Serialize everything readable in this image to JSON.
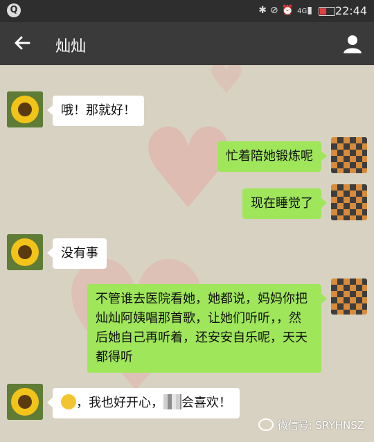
{
  "status_bar": {
    "app_icon_letter": "Q",
    "network": "4G",
    "time": "22:44"
  },
  "header": {
    "title": "灿灿",
    "back_icon": "arrow-left-icon",
    "profile_icon": "user-profile-icon"
  },
  "messages": [
    {
      "side": "left",
      "text": "哦！那就好！"
    },
    {
      "side": "right",
      "text": "忙着陪她锻炼呢"
    },
    {
      "side": "right",
      "text": "现在睡觉了"
    },
    {
      "side": "left",
      "text": "没有事"
    },
    {
      "side": "right",
      "text": "不管谁去医院看她，她都说，妈妈你把灿灿阿姨唱那首歌，让她们听听，，然后她自己再听着，还安安自乐呢，天天都得听"
    },
    {
      "side": "left",
      "text_after_emoji": "，我也好开心，",
      "text_after_blur": "会喜欢！"
    }
  ],
  "watermark": "微信号: SRYHNSZ",
  "colors": {
    "sent_bubble": "#9fe65a",
    "received_bubble": "#ffffff",
    "header_bg": "#3a3a3a"
  }
}
